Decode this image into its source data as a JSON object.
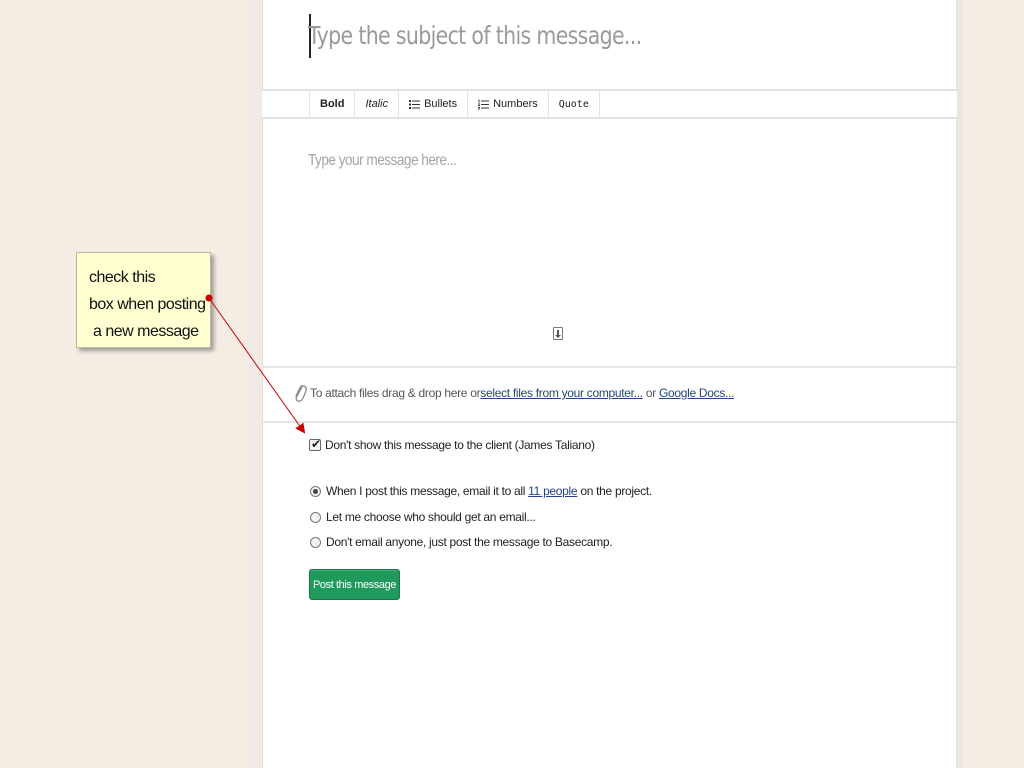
{
  "message_form": {
    "subject_placeholder": "Type the subject of this message...",
    "body_placeholder": "Type your message here...",
    "toolbar": {
      "bold": "Bold",
      "italic": "Italic",
      "bullets": "Bullets",
      "numbers": "Numbers",
      "quote": "Quote"
    },
    "attach": {
      "prefix": "To attach files drag & drop here or ",
      "select_link": "select files from your computer...",
      "or": " or ",
      "google_link": "Google Docs..."
    },
    "client_checkbox": {
      "label": "Don't show this message to the client (James Taliano)",
      "checked": true
    },
    "email_options": {
      "option1_prefix": "When I post this message, email it to all ",
      "option1_link": "11 people",
      "option1_suffix": " on the project.",
      "option2": "Let me choose who should get an email...",
      "option3": "Don't email anyone, just post the message to Basecamp.",
      "selected": 0
    },
    "post_button": "Post this message"
  },
  "annotation": {
    "line1": "check this",
    "line2": "box when posting",
    "line3": "a new message",
    "background": "#ffffd2",
    "arrow_color": "#cc0000"
  },
  "colors": {
    "page_background": "#f5ede4",
    "button_green": "#1f9a5c",
    "link": "#224488"
  }
}
